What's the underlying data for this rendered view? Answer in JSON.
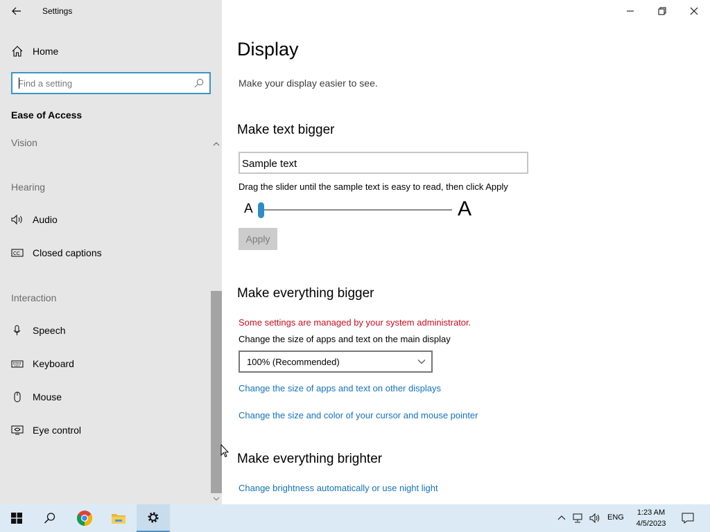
{
  "window": {
    "title": "Settings",
    "controls": {
      "minimize_icon": "minimize-icon",
      "maximize_icon": "restore-icon",
      "close_icon": "close-icon"
    }
  },
  "sidebar": {
    "home_label": "Home",
    "search_placeholder": "Find a setting",
    "section_title": "Ease of Access",
    "groups": {
      "vision": "Vision",
      "hearing": "Hearing",
      "interaction": "Interaction"
    },
    "items": [
      {
        "label": "Audio",
        "icon": "speaker-icon"
      },
      {
        "label": "Closed captions",
        "icon": "cc-icon"
      },
      {
        "label": "Speech",
        "icon": "microphone-icon"
      },
      {
        "label": "Keyboard",
        "icon": "keyboard-icon"
      },
      {
        "label": "Mouse",
        "icon": "mouse-icon"
      },
      {
        "label": "Eye control",
        "icon": "eye-control-icon"
      }
    ]
  },
  "main": {
    "page_title": "Display",
    "page_description": "Make your display easier to see.",
    "text_bigger": {
      "heading": "Make text bigger",
      "sample_text": "Sample text",
      "hint": "Drag the slider until the sample text is easy to read, then click Apply",
      "small_a": "A",
      "big_a": "A",
      "slider_value_percent": 0,
      "apply_label": "Apply"
    },
    "everything_bigger": {
      "heading": "Make everything bigger",
      "admin_warning": "Some settings are managed by your system administrator.",
      "scale_label": "Change the size of apps and text on the main display",
      "scale_value": "100% (Recommended)",
      "link_other_displays": "Change the size of apps and text on other displays",
      "link_cursor": "Change the size and color of your cursor and mouse pointer"
    },
    "everything_brighter": {
      "heading": "Make everything brighter",
      "link_brightness": "Change brightness automatically or use night light"
    }
  },
  "taskbar": {
    "language": "ENG",
    "time": "1:23 AM",
    "date": "4/5/2023",
    "accent": "#2e8dc4"
  }
}
